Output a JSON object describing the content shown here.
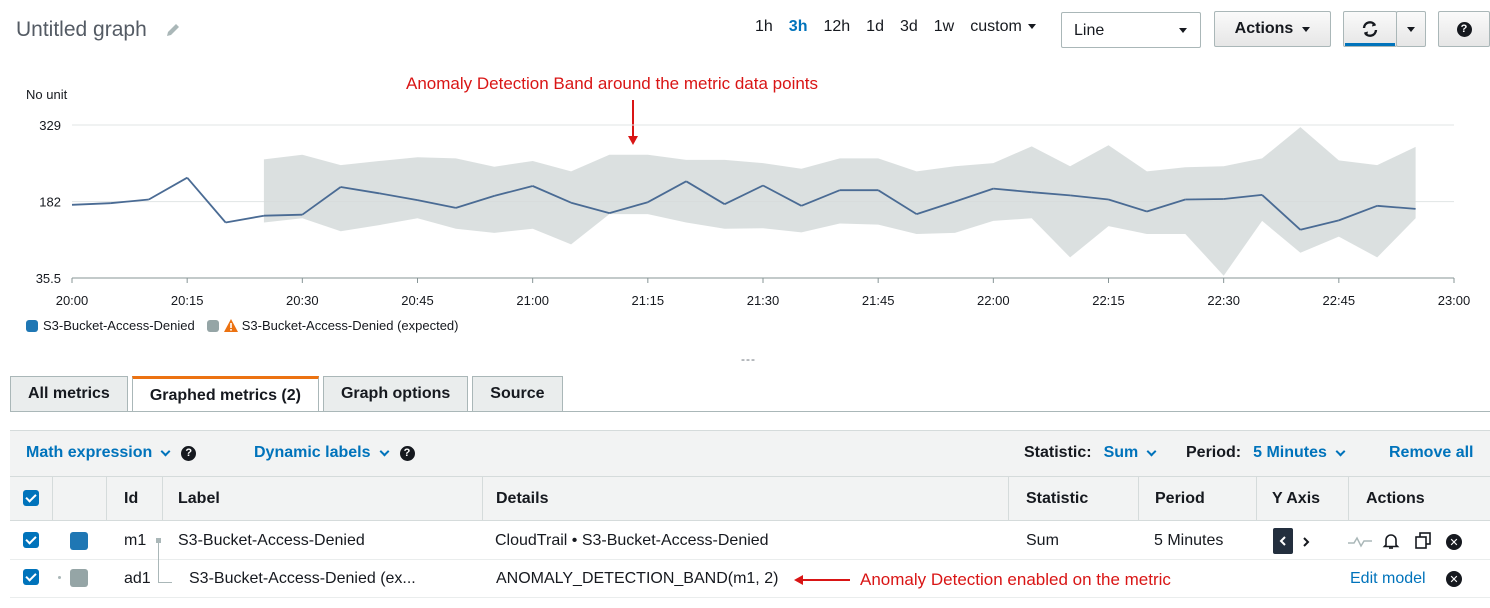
{
  "header": {
    "title": "Untitled graph",
    "time_ranges": [
      "1h",
      "3h",
      "12h",
      "1d",
      "3d",
      "1w"
    ],
    "active_range": "3h",
    "custom_label": "custom",
    "chart_type": "Line",
    "actions_label": "Actions"
  },
  "annotations": {
    "top": "Anomaly Detection Band around the metric data points",
    "bottom": "Anomaly Detection enabled on the metric"
  },
  "chart_data": {
    "type": "line",
    "unit_label": "No unit",
    "y_ticks": [
      "329",
      "182",
      "35.5"
    ],
    "ylim": [
      35.5,
      329
    ],
    "x_ticks": [
      "20:00",
      "20:15",
      "20:30",
      "20:45",
      "21:00",
      "21:15",
      "21:30",
      "21:45",
      "22:00",
      "22:15",
      "22:30",
      "22:45",
      "23:00"
    ],
    "x": [
      "20:00",
      "20:05",
      "20:10",
      "20:15",
      "20:20",
      "20:25",
      "20:30",
      "20:35",
      "20:40",
      "20:45",
      "20:50",
      "20:55",
      "21:00",
      "21:05",
      "21:10",
      "21:15",
      "21:20",
      "21:25",
      "21:30",
      "21:35",
      "21:40",
      "21:45",
      "21:50",
      "21:55",
      "22:00",
      "22:05",
      "22:10",
      "22:15",
      "22:20",
      "22:25",
      "22:30",
      "22:35",
      "22:40",
      "22:45",
      "22:50",
      "22:55"
    ],
    "series": [
      {
        "name": "S3-Bucket-Access-Denied",
        "color": "#4a6b94",
        "values": [
          176,
          179,
          186,
          228,
          142,
          155,
          157,
          210,
          198,
          185,
          170,
          193,
          212,
          180,
          160,
          181,
          221,
          177,
          213,
          174,
          204,
          204,
          158,
          182,
          207,
          200,
          194,
          186,
          163,
          186,
          187,
          195,
          128,
          146,
          174,
          168
        ]
      },
      {
        "name": "S3-Bucket-Access-Denied (expected)",
        "color": "#d5dbdb",
        "band_start": "20:25",
        "upper": [
          null,
          null,
          null,
          null,
          null,
          263,
          272,
          252,
          260,
          267,
          265,
          249,
          260,
          240,
          272,
          272,
          262,
          262,
          256,
          245,
          265,
          265,
          240,
          250,
          256,
          288,
          250,
          290,
          240,
          248,
          250,
          265,
          325,
          261,
          252,
          287
        ],
        "lower": [
          null,
          null,
          null,
          null,
          null,
          142,
          150,
          125,
          137,
          150,
          130,
          122,
          130,
          100,
          158,
          158,
          142,
          130,
          131,
          123,
          140,
          138,
          120,
          122,
          145,
          150,
          75,
          135,
          120,
          120,
          40,
          145,
          84,
          115,
          75,
          150
        ]
      }
    ],
    "anomaly_color": "#e00000"
  },
  "legend": {
    "main": "S3-Bucket-Access-Denied",
    "expected": "S3-Bucket-Access-Denied (expected)"
  },
  "tabs": [
    "All metrics",
    "Graphed metrics (2)",
    "Graph options",
    "Source"
  ],
  "active_tab": "Graphed metrics (2)",
  "toolbar": {
    "math_expression": "Math expression",
    "dynamic_labels": "Dynamic labels",
    "statistic_label": "Statistic:",
    "statistic_value": "Sum",
    "period_label": "Period:",
    "period_value": "5 Minutes",
    "remove_all": "Remove all"
  },
  "table": {
    "headers": [
      "Id",
      "Label",
      "Details",
      "Statistic",
      "Period",
      "Y Axis",
      "Actions"
    ],
    "rows": [
      {
        "id": "m1",
        "label": "S3-Bucket-Access-Denied",
        "details_source": "CloudTrail",
        "details_metric": "S3-Bucket-Access-Denied",
        "statistic": "Sum",
        "period": "5 Minutes",
        "color": "#1f77b4"
      },
      {
        "id": "ad1",
        "label": "S3-Bucket-Access-Denied (ex...",
        "details": "ANOMALY_DETECTION_BAND(m1, 2)",
        "edit_model": "Edit model",
        "color": "#95a5a6"
      }
    ]
  },
  "divider": "---"
}
